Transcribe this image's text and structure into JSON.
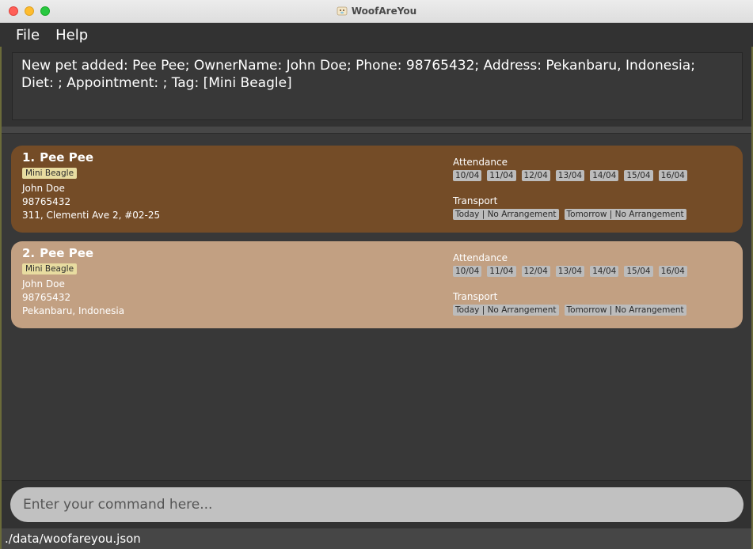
{
  "window": {
    "title": "WoofAreYou",
    "app_icon": "dog-app-icon"
  },
  "menu": {
    "file": "File",
    "help": "Help"
  },
  "result": {
    "line1": "New pet added: Pee Pee; OwnerName: John Doe; Phone: 98765432; Address: Pekanbaru, Indonesia;",
    "line2": "Diet: ; Appointment: ; Tag: [Mini Beagle]"
  },
  "pets": [
    {
      "index": "1.",
      "name": "Pee Pee",
      "tag": "Mini Beagle",
      "owner": "John Doe",
      "phone": "98765432",
      "address": "311, Clementi Ave 2, #02-25",
      "attendance_label": "Attendance",
      "attendance": [
        "10/04",
        "11/04",
        "12/04",
        "13/04",
        "14/04",
        "15/04",
        "16/04"
      ],
      "transport_label": "Transport",
      "transport": [
        "Today | No Arrangement",
        "Tomorrow | No Arrangement"
      ]
    },
    {
      "index": "2.",
      "name": "Pee Pee",
      "tag": "Mini Beagle",
      "owner": "John Doe",
      "phone": "98765432",
      "address": "Pekanbaru, Indonesia",
      "attendance_label": "Attendance",
      "attendance": [
        "10/04",
        "11/04",
        "12/04",
        "13/04",
        "14/04",
        "15/04",
        "16/04"
      ],
      "transport_label": "Transport",
      "transport": [
        "Today | No Arrangement",
        "Tomorrow | No Arrangement"
      ]
    }
  ],
  "command": {
    "placeholder": "Enter your command here...",
    "value": ""
  },
  "status": {
    "path": "./data/woofareyou.json"
  },
  "colors": {
    "card_selected": "#744c27",
    "card_default": "#c2a082",
    "tag_bg": "#e8dca0",
    "chip_bg": "#bcbcbc"
  }
}
